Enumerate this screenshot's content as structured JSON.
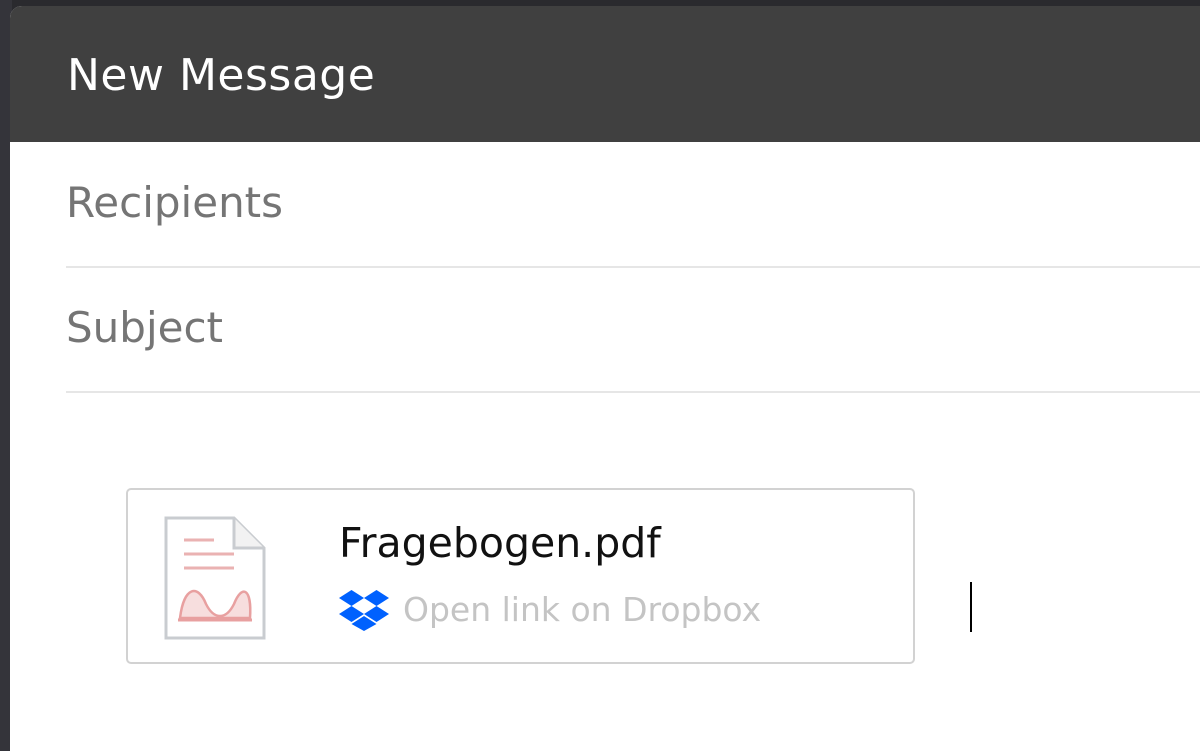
{
  "compose": {
    "title": "New Message",
    "recipients_placeholder": "Recipients",
    "subject_placeholder": "Subject"
  },
  "attachment": {
    "file_name": "Fragebogen.pdf",
    "link_label": "Open link on Dropbox",
    "file_icon": "pdf-file-icon",
    "link_icon": "dropbox-icon"
  },
  "colors": {
    "titlebar": "#404040",
    "dropbox_blue": "#0061FE",
    "pdf_accent": "#e8a0a0"
  }
}
